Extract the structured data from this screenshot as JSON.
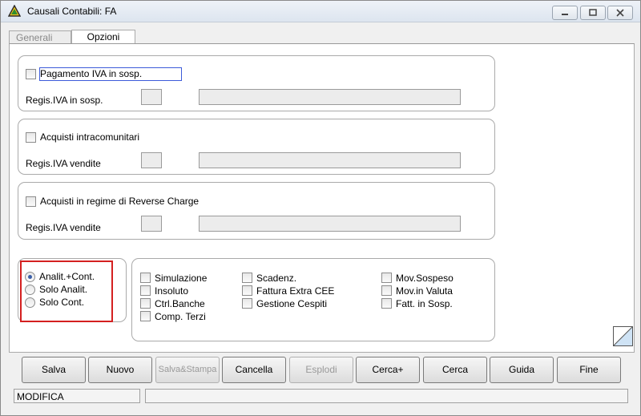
{
  "window": {
    "title": "Causali Contabili: FA"
  },
  "tabs": [
    {
      "label": "Generali"
    },
    {
      "label": "Opzioni"
    }
  ],
  "group1": {
    "checkbox_label": "Pagamento IVA in sosp.",
    "field_label": "Regis.IVA in sosp."
  },
  "group2": {
    "checkbox_label": "Acquisti intracomunitari",
    "field_label": "Regis.IVA vendite"
  },
  "group3": {
    "checkbox_label": "Acquisti in regime di Reverse Charge",
    "field_label": "Regis.IVA vendite"
  },
  "radios": [
    {
      "label": "Analit.+Cont.",
      "selected": true
    },
    {
      "label": "Solo Analit.",
      "selected": false
    },
    {
      "label": "Solo Cont.",
      "selected": false
    }
  ],
  "options": {
    "col1": [
      "Simulazione",
      "Insoluto",
      "Ctrl.Banche",
      "Comp. Terzi"
    ],
    "col2": [
      "Scadenz.",
      "Fattura Extra CEE",
      "Gestione Cespiti"
    ],
    "col3": [
      "Mov.Sospeso",
      "Mov.in Valuta",
      "Fatt. in Sosp."
    ]
  },
  "buttons": {
    "salva": "Salva",
    "nuovo": "Nuovo",
    "salva_stampa": "Salva&Stampa",
    "cancella": "Cancella",
    "esplodi": "Esplodi",
    "cerca_plus": "Cerca+",
    "cerca": "Cerca",
    "guida": "Guida",
    "fine": "Fine"
  },
  "status": {
    "mode": "MODIFICA",
    "message": ""
  }
}
